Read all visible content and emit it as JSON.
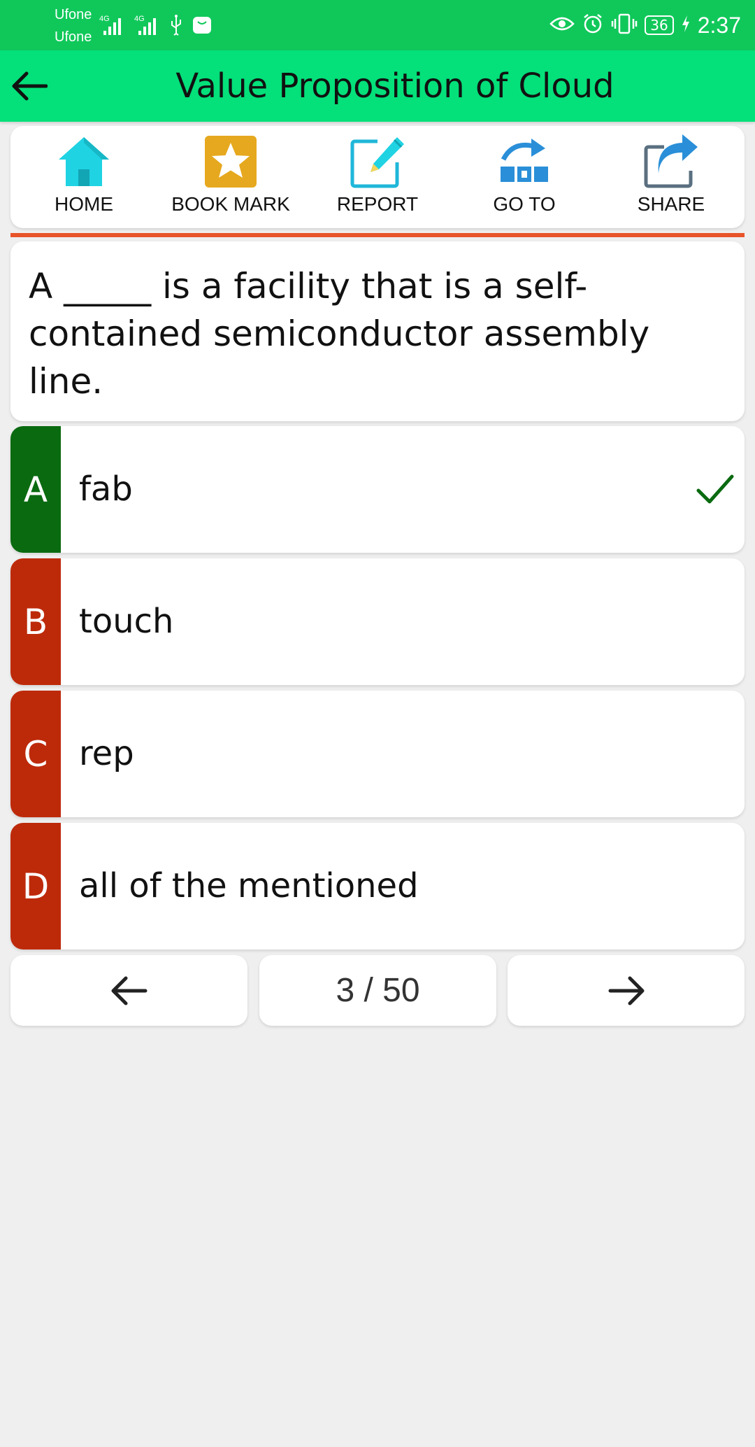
{
  "status_bar": {
    "carrier_1": "Ufone",
    "carrier_2": "Ufone",
    "signal_1_label": "4G",
    "signal_2_label": "4G",
    "battery": "36",
    "time": "2:37"
  },
  "app_bar": {
    "title": "Value Proposition of Cloud",
    "back_icon": "arrow-left-icon"
  },
  "toolbar": {
    "items": [
      {
        "label": "HOME",
        "icon": "home-icon",
        "color": "#1fd3e3"
      },
      {
        "label": "BOOK MARK",
        "icon": "star-icon",
        "color": "#e6a81e"
      },
      {
        "label": "REPORT",
        "icon": "edit-icon",
        "color": "#1fb7d9"
      },
      {
        "label": "GO TO",
        "icon": "goto-icon",
        "color": "#2a8fd8"
      },
      {
        "label": "SHARE",
        "icon": "share-icon",
        "color": "#2a8fd8"
      }
    ]
  },
  "divider_color": "#e8542a",
  "question": {
    "text": " A _____ is a facility that is a self-contained semiconductor assembly line."
  },
  "options": [
    {
      "letter": "A",
      "text": "fab",
      "color": "#0a6a10",
      "correct": true
    },
    {
      "letter": "B",
      "text": "touch",
      "color": "#bd2a0a",
      "correct": false
    },
    {
      "letter": "C",
      "text": "rep",
      "color": "#bd2a0a",
      "correct": false
    },
    {
      "letter": "D",
      "text": "all of the mentioned",
      "color": "#bd2a0a",
      "correct": false
    }
  ],
  "navigation": {
    "counter": "3 / 50",
    "prev_icon": "arrow-left-icon",
    "next_icon": "arrow-right-icon"
  },
  "colors": {
    "status_bar": "#10c85a",
    "app_bar": "#04e07a",
    "background": "#efefef",
    "check": "#0a6a10"
  }
}
